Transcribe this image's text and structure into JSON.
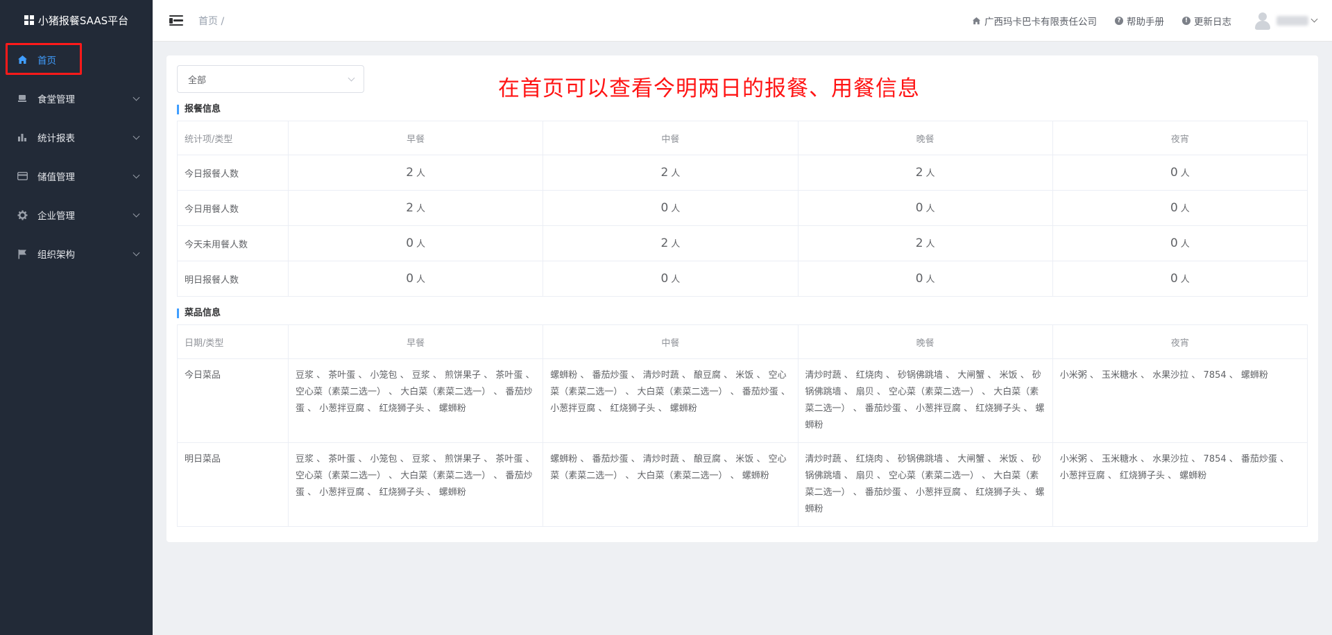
{
  "brand": {
    "title": "小猪报餐SAAS平台"
  },
  "sidebar": {
    "items": [
      {
        "label": "首页",
        "icon": "home-icon",
        "active": true
      },
      {
        "label": "食堂管理",
        "icon": "canteen-icon"
      },
      {
        "label": "统计报表",
        "icon": "bar-chart-icon"
      },
      {
        "label": "储值管理",
        "icon": "card-icon"
      },
      {
        "label": "企业管理",
        "icon": "gear-icon"
      },
      {
        "label": "组织架构",
        "icon": "flag-icon"
      }
    ]
  },
  "header": {
    "breadcrumb": "首页 /",
    "company": "广西玛卡巴卡有限责任公司",
    "help": "帮助手册",
    "changelog": "更新日志"
  },
  "filter": {
    "selected": "全部"
  },
  "notice": "在首页可以查看今明两日的报餐、用餐信息",
  "meal_section": {
    "title": "报餐信息",
    "headers": [
      "统计项/类型",
      "早餐",
      "中餐",
      "晚餐",
      "夜宵"
    ],
    "unit": "人",
    "rows": [
      {
        "label": "今日报餐人数",
        "values": [
          "2",
          "2",
          "2",
          "0"
        ]
      },
      {
        "label": "今日用餐人数",
        "values": [
          "2",
          "0",
          "0",
          "0"
        ]
      },
      {
        "label": "今天未用餐人数",
        "values": [
          "0",
          "2",
          "2",
          "0"
        ]
      },
      {
        "label": "明日报餐人数",
        "values": [
          "0",
          "0",
          "0",
          "0"
        ]
      }
    ]
  },
  "dish_section": {
    "title": "菜品信息",
    "headers": [
      "日期/类型",
      "早餐",
      "中餐",
      "晚餐",
      "夜宵"
    ],
    "rows": [
      {
        "label": "今日菜品",
        "values": [
          "豆浆 、 茶叶蛋 、 小笼包 、 豆浆 、 煎饼果子 、 茶叶蛋 、 空心菜（素菜二选一） 、 大白菜（素菜二选一） 、 番茄炒蛋 、 小葱拌豆腐 、 红烧狮子头 、 螺蛳粉",
          "螺蛳粉 、 番茄炒蛋 、 清炒时蔬 、 酿豆腐 、 米饭 、 空心菜（素菜二选一） 、 大白菜（素菜二选一） 、 番茄炒蛋 、 小葱拌豆腐 、 红烧狮子头 、 螺蛳粉",
          "清炒时蔬 、 红烧肉 、 砂锅佛跳墙 、 大闸蟹 、 米饭 、 砂锅佛跳墙 、 扇贝 、 空心菜（素菜二选一） 、 大白菜（素菜二选一） 、 番茄炒蛋 、 小葱拌豆腐 、 红烧狮子头 、 螺蛳粉",
          "小米粥 、 玉米糖水 、 水果沙拉 、 7854 、 螺蛳粉"
        ]
      },
      {
        "label": "明日菜品",
        "values": [
          "豆浆 、 茶叶蛋 、 小笼包 、 豆浆 、 煎饼果子 、 茶叶蛋 、 空心菜（素菜二选一） 、 大白菜（素菜二选一） 、 番茄炒蛋 、 小葱拌豆腐 、 红烧狮子头 、 螺蛳粉",
          "螺蛳粉 、 番茄炒蛋 、 清炒时蔬 、 酿豆腐 、 米饭 、 空心菜（素菜二选一） 、 大白菜（素菜二选一） 、 螺蛳粉",
          "清炒时蔬 、 红烧肉 、 砂锅佛跳墙 、 大闸蟹 、 米饭 、 砂锅佛跳墙 、 扇贝 、 空心菜（素菜二选一） 、 大白菜（素菜二选一） 、 番茄炒蛋 、 小葱拌豆腐 、 红烧狮子头 、 螺蛳粉",
          "小米粥 、 玉米糖水 、 水果沙拉 、 7854 、 番茄炒蛋 、 小葱拌豆腐 、 红烧狮子头 、 螺蛳粉"
        ]
      }
    ]
  },
  "colors": {
    "accent": "#409eff",
    "sidebar_bg": "#222a37",
    "highlight": "#ff1a1a"
  }
}
